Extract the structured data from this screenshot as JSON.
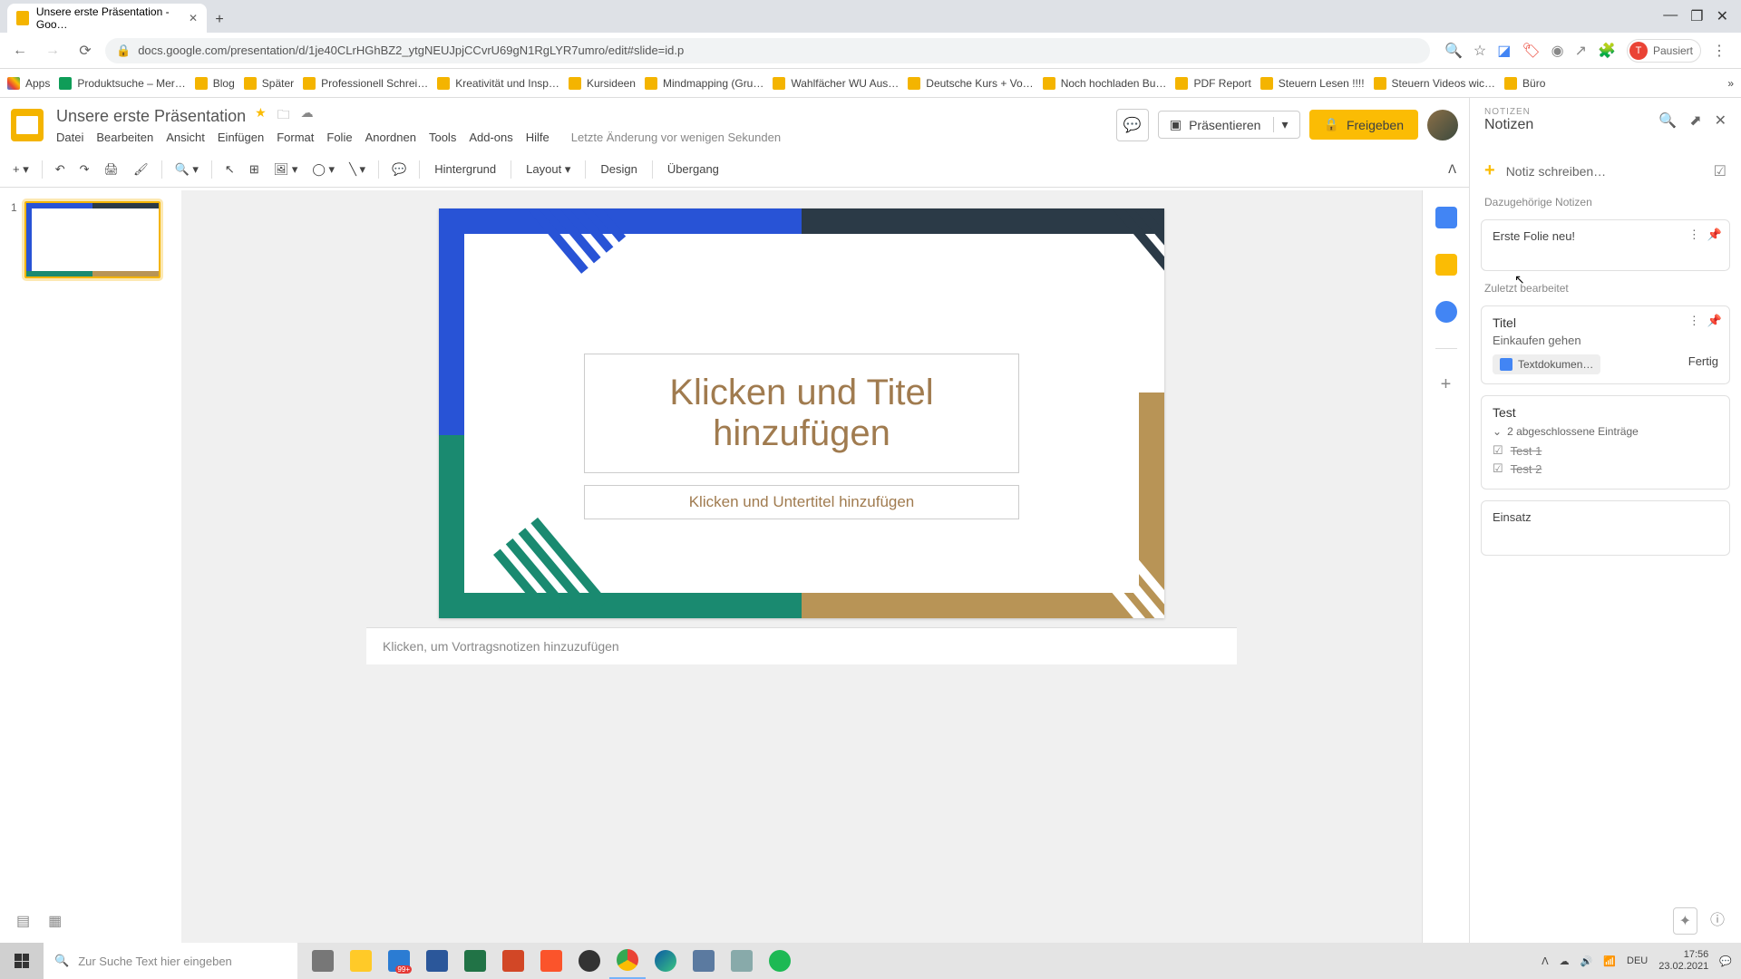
{
  "browser": {
    "tab_title": "Unsere erste Präsentation - Goo…",
    "url": "docs.google.com/presentation/d/1je40CLrHGhBZ2_ytgNEUJpjCCvrU69gN1RgLYR7umro/edit#slide=id.p",
    "paused_label": "Pausiert",
    "paused_initial": "T"
  },
  "bookmarks": {
    "apps": "Apps",
    "items": [
      "Produktsuche – Mer…",
      "Blog",
      "Später",
      "Professionell Schrei…",
      "Kreativität und Insp…",
      "Kursideen",
      "Mindmapping (Gru…",
      "Wahlfächer WU Aus…",
      "Deutsche Kurs + Vo…",
      "Noch hochladen Bu…",
      "PDF Report",
      "Steuern Lesen !!!!",
      "Steuern Videos wic…",
      "Büro"
    ]
  },
  "app": {
    "title": "Unsere erste Präsentation",
    "menus": [
      "Datei",
      "Bearbeiten",
      "Ansicht",
      "Einfügen",
      "Format",
      "Folie",
      "Anordnen",
      "Tools",
      "Add-ons",
      "Hilfe"
    ],
    "last_edit": "Letzte Änderung vor wenigen Sekunden",
    "present": "Präsentieren",
    "share": "Freigeben"
  },
  "toolbar": {
    "background": "Hintergrund",
    "layout": "Layout",
    "design": "Design",
    "transition": "Übergang"
  },
  "slide": {
    "number": "1",
    "title_placeholder": "Klicken und Titel hinzufügen",
    "subtitle_placeholder": "Klicken und Untertitel hinzufügen",
    "notes_placeholder": "Klicken, um Vortragsnotizen hinzuzufügen"
  },
  "notes_panel": {
    "eyebrow": "NOTIZEN",
    "title": "Notizen",
    "new_note": "Notiz schreiben…",
    "section_related": "Dazugehörige Notizen",
    "section_recent": "Zuletzt bearbeitet",
    "note1_text": "Erste Folie neu!",
    "note2_title": "Titel",
    "note2_body": "Einkaufen gehen",
    "note2_chip": "Textdokumen…",
    "note2_done": "Fertig",
    "note3_title": "Test",
    "note3_collapse": "2 abgeschlossene Einträge",
    "note3_item1": "Test 1",
    "note3_item2": "Test 2",
    "note4_text": "Einsatz"
  },
  "taskbar": {
    "search_placeholder": "Zur Suche Text hier eingeben",
    "badge": "99+",
    "lang": "DEU",
    "time": "17:56",
    "date": "23.02.2021"
  }
}
